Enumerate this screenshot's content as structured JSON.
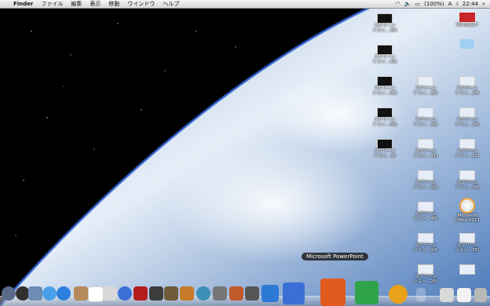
{
  "menubar": {
    "items": [
      "Finder",
      "ファイル",
      "編集",
      "表示",
      "移動",
      "ウインドウ",
      "ヘルプ"
    ],
    "battery": "(100%)",
    "clock": "☾ 22:44",
    "input": "A"
  },
  "desktop_icons": [
    {
      "label": "スクリーン\nショッ…30)"
    },
    {
      "label": "スクリーン\nショッ…46)"
    },
    {
      "label": "スクリーン\nショッ…09)"
    },
    {
      "label": "スクリーン\nショッ…02)"
    },
    {
      "label": "スクリーン\nショッ…5)"
    },
    {
      "label": "スクリーン\nショッ…29)"
    },
    {
      "label": "スクリーン\nショッ…33)"
    },
    {
      "label": "スクリーン\nショッ…41)"
    },
    {
      "label": "スクリーン\nショッ…02)"
    },
    {
      "label": "スクリーン\nショッ…48)"
    },
    {
      "label": "スクリーン\nショッ…14)"
    },
    {
      "label": "スクリーン\nショッ…29)"
    },
    {
      "label": "Windows7"
    },
    {
      "label": ""
    },
    {
      "label": "スクリーン\nショッ…24)"
    },
    {
      "label": "スクリーン\nショッ…39)"
    },
    {
      "label": "スクリーン\nショッ…22)"
    },
    {
      "label": "スクリーン\nショッ…04)"
    },
    {
      "label": "Microsoft\nOffice 2011"
    },
    {
      "label": "スクリーン\nショッ…35)"
    },
    {
      "label": ""
    }
  ],
  "dock": {
    "tooltip": "Microsoft PowerPoint"
  }
}
